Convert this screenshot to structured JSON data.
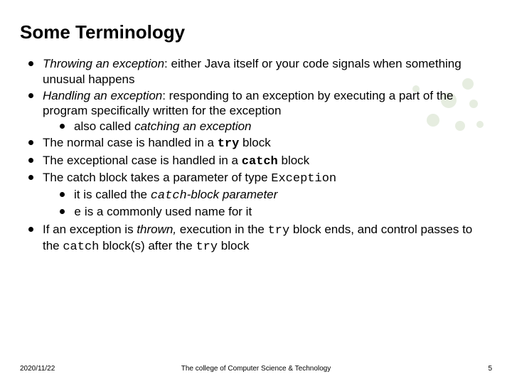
{
  "title": "Some Terminology",
  "b1_a": "Throwing an exception",
  "b1_b": ": either Java itself or your code signals when something unusual happens",
  "b2_a": "Handling an exception",
  "b2_b": ": responding to an exception by executing a part of the program specifically written for the exception",
  "b2s1_a": "also called ",
  "b2s1_b": "catching an exception",
  "b3_a": "The normal case is handled in a ",
  "b3_b": "try",
  "b3_c": " block",
  "b4_a": "The exceptional case is handled in a ",
  "b4_b": "catch",
  "b4_c": " block",
  "b5_a": "The catch block takes a parameter of type ",
  "b5_b": "Exception",
  "b5s1_a": "it is called the ",
  "b5s1_b": "catch",
  "b5s1_c": "-block parameter",
  "b5s2_a": "e",
  "b5s2_b": " is a commonly used name for it",
  "b6_a": "If an exception is ",
  "b6_b": "thrown,",
  "b6_c": " execution in the ",
  "b6_d": "try",
  "b6_e": " block ends, and control passes to the ",
  "b6_f": "catch",
  "b6_g": " block(s)  after the ",
  "b6_h": "try",
  "b6_i": " block",
  "footer_date": "2020/11/22",
  "footer_center": "The college of Computer Science & Technology",
  "footer_page": "5"
}
